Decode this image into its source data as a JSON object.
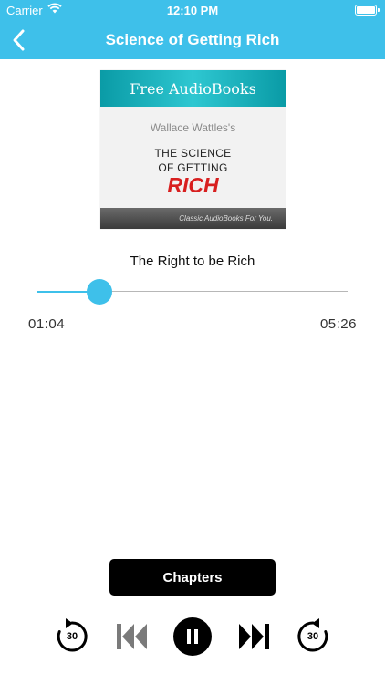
{
  "status_bar": {
    "carrier": "Carrier",
    "time": "12:10 PM"
  },
  "nav": {
    "title": "Science of Getting Rich",
    "back_icon": "chevron-left-icon"
  },
  "cover": {
    "header": "Free AudioBooks",
    "author": "Wallace Wattles's",
    "title_line1": "THE SCIENCE",
    "title_line2": "OF GETTING",
    "title_line3": "RICH",
    "footer": "Classic AudioBooks For You."
  },
  "player": {
    "track_title": "The Right to be Rich",
    "elapsed": "01:04",
    "duration": "05:26",
    "progress_fraction": 0.2,
    "accent_color": "#3ec0ea"
  },
  "controls": {
    "chapters_label": "Chapters",
    "rewind_label": "30",
    "forward_label": "30"
  }
}
